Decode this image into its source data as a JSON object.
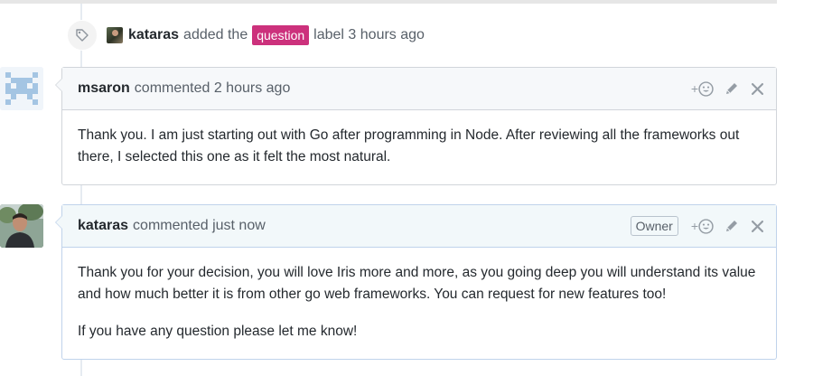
{
  "event": {
    "icon": "tag-icon",
    "actor": "kataras",
    "action_text": "added the",
    "label": "question",
    "label_color": "#cc317c",
    "suffix": "label 3 hours ago"
  },
  "comments": [
    {
      "author": "msaron",
      "meta": "commented 2 hours ago",
      "owner_badge": "",
      "body": [
        "Thank you. I am just starting out with Go after programming in Node. After reviewing all the frameworks out there, I selected this one as it felt the most natural."
      ]
    },
    {
      "author": "kataras",
      "meta": "commented just now",
      "owner_badge": "Owner",
      "body": [
        "Thank you for your decision, you will love Iris more and more, as you going deep you will understand its value and how much better it is from other go web frameworks. You can request for new features too!",
        "If you have any question please let me know!"
      ]
    }
  ],
  "actions": {
    "reaction": "+",
    "icons": [
      "smiley-icon",
      "pencil-icon",
      "close-icon"
    ]
  }
}
